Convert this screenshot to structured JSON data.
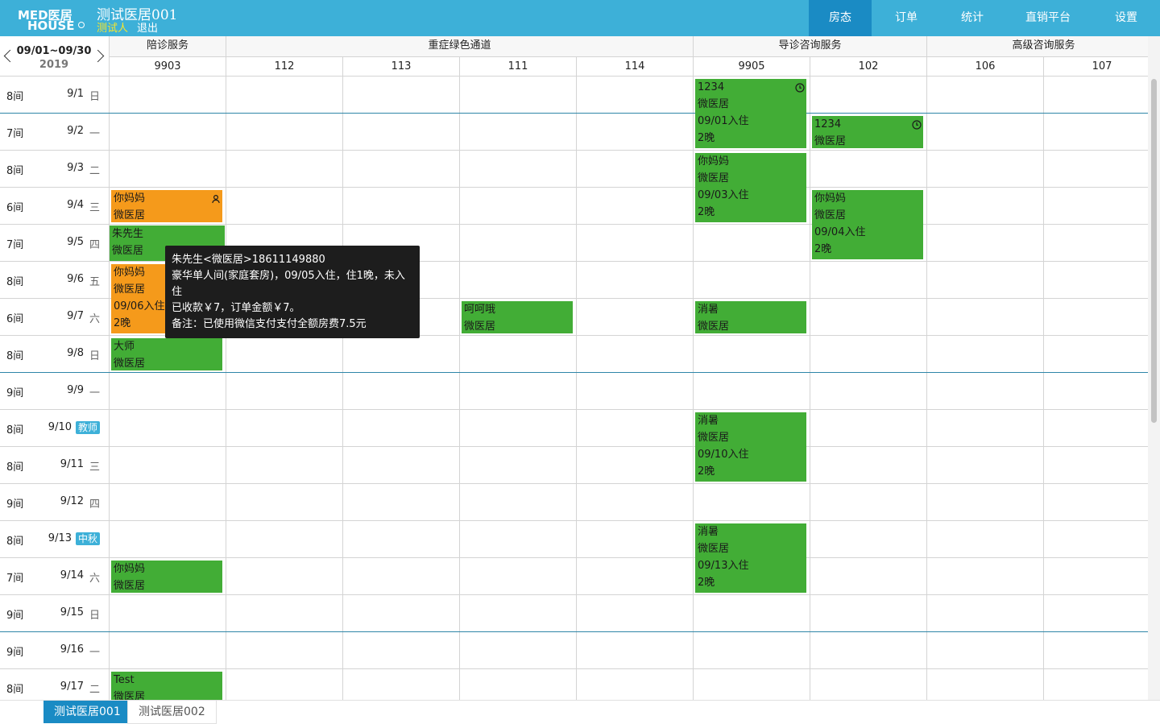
{
  "header": {
    "logo_top": "MED医居",
    "logo_bottom": "HOUSE",
    "hotel_name": "测试医居001",
    "user_name": "测试人",
    "logout_label": "退出",
    "nav": [
      {
        "label": "房态",
        "active": true
      },
      {
        "label": "订单",
        "active": false
      },
      {
        "label": "统计",
        "active": false
      },
      {
        "label": "直销平台",
        "active": false
      },
      {
        "label": "设置",
        "active": false
      }
    ]
  },
  "calendar": {
    "date_range": "09/01~09/30",
    "year": "2019",
    "groups": [
      "陪诊服务",
      "重症绿色通道",
      "导诊咨询服务",
      "高级咨询服务"
    ],
    "rooms": [
      "9903",
      "112",
      "113",
      "111",
      "114",
      "9905",
      "102",
      "106",
      "107"
    ],
    "rows": [
      {
        "count": "8间",
        "date": "9/1",
        "weekday": "日"
      },
      {
        "count": "7间",
        "date": "9/2",
        "weekday": "一"
      },
      {
        "count": "8间",
        "date": "9/3",
        "weekday": "二"
      },
      {
        "count": "6间",
        "date": "9/4",
        "weekday": "三"
      },
      {
        "count": "7间",
        "date": "9/5",
        "weekday": "四"
      },
      {
        "count": "8间",
        "date": "9/6",
        "weekday": "五"
      },
      {
        "count": "6间",
        "date": "9/7",
        "weekday": "六"
      },
      {
        "count": "8间",
        "date": "9/8",
        "weekday": "日"
      },
      {
        "count": "9间",
        "date": "9/9",
        "weekday": "一"
      },
      {
        "count": "8间",
        "date": "9/10",
        "holiday": "教师"
      },
      {
        "count": "8间",
        "date": "9/11",
        "weekday": "三"
      },
      {
        "count": "9间",
        "date": "9/12",
        "weekday": "四"
      },
      {
        "count": "8间",
        "date": "9/13",
        "holiday": "中秋"
      },
      {
        "count": "7间",
        "date": "9/14",
        "weekday": "六"
      },
      {
        "count": "9间",
        "date": "9/15",
        "weekday": "日"
      },
      {
        "count": "9间",
        "date": "9/16",
        "weekday": "一"
      },
      {
        "count": "8间",
        "date": "9/17",
        "weekday": "二"
      }
    ],
    "bookings": [
      {
        "room": 5,
        "start": 0,
        "nights": 2,
        "color": "green",
        "lines": [
          "1234",
          "微医居",
          "09/01入住",
          "2晚"
        ],
        "icon": "clock-icon"
      },
      {
        "room": 6,
        "start": 1,
        "nights": 1,
        "color": "green",
        "lines": [
          "1234",
          "微医居"
        ],
        "icon": "clock-icon"
      },
      {
        "room": 5,
        "start": 2,
        "nights": 2,
        "color": "green",
        "lines": [
          "你妈妈",
          "微医居",
          "09/03入住",
          "2晚"
        ]
      },
      {
        "room": 0,
        "start": 3,
        "nights": 1,
        "color": "orange",
        "lines": [
          "你妈妈",
          "微医居"
        ],
        "icon": "person-icon"
      },
      {
        "room": 6,
        "start": 3,
        "nights": 2,
        "color": "green",
        "lines": [
          "你妈妈",
          "微医居",
          "09/04入住",
          "2晚"
        ]
      },
      {
        "room": 0,
        "start": 4,
        "nights": 1,
        "color": "green",
        "lines": [
          "朱先生",
          "微医居"
        ],
        "hover": true
      },
      {
        "room": 0,
        "start": 5,
        "nights": 2,
        "color": "orange",
        "lines": [
          "你妈妈",
          "微医居",
          "09/06入住",
          "2晚"
        ]
      },
      {
        "room": 3,
        "start": 6,
        "nights": 1,
        "color": "green",
        "lines": [
          "呵呵哦",
          "微医居"
        ]
      },
      {
        "room": 5,
        "start": 6,
        "nights": 1,
        "color": "green",
        "lines": [
          "消暑",
          "微医居"
        ]
      },
      {
        "room": 0,
        "start": 7,
        "nights": 1,
        "color": "green",
        "lines": [
          "大师",
          "微医居"
        ]
      },
      {
        "room": 5,
        "start": 9,
        "nights": 2,
        "color": "green",
        "lines": [
          "消暑",
          "微医居",
          "09/10入住",
          "2晚"
        ]
      },
      {
        "room": 5,
        "start": 12,
        "nights": 2,
        "color": "green",
        "lines": [
          "消暑",
          "微医居",
          "09/13入住",
          "2晚"
        ]
      },
      {
        "room": 0,
        "start": 13,
        "nights": 1,
        "color": "green",
        "lines": [
          "你妈妈",
          "微医居"
        ]
      },
      {
        "room": 0,
        "start": 16,
        "nights": 1,
        "color": "green",
        "lines": [
          "Test",
          "微医居"
        ]
      }
    ],
    "colors": {
      "green": "#42ad36",
      "orange": "#f59a1b",
      "header": "#3db0d8",
      "active_nav": "#1a8bc4"
    }
  },
  "tooltip": {
    "line1": "朱先生<微医居>18611149880",
    "line2": "豪华单人间(家庭套房)，09/05入住，住1晚，未入住",
    "line3": "已收款￥7，订单金额￥7。",
    "line4": "备注：已使用微信支付支付全额房费7.5元"
  },
  "tabs": [
    {
      "label": "测试医居001",
      "active": true
    },
    {
      "label": "测试医居002",
      "active": false
    }
  ]
}
